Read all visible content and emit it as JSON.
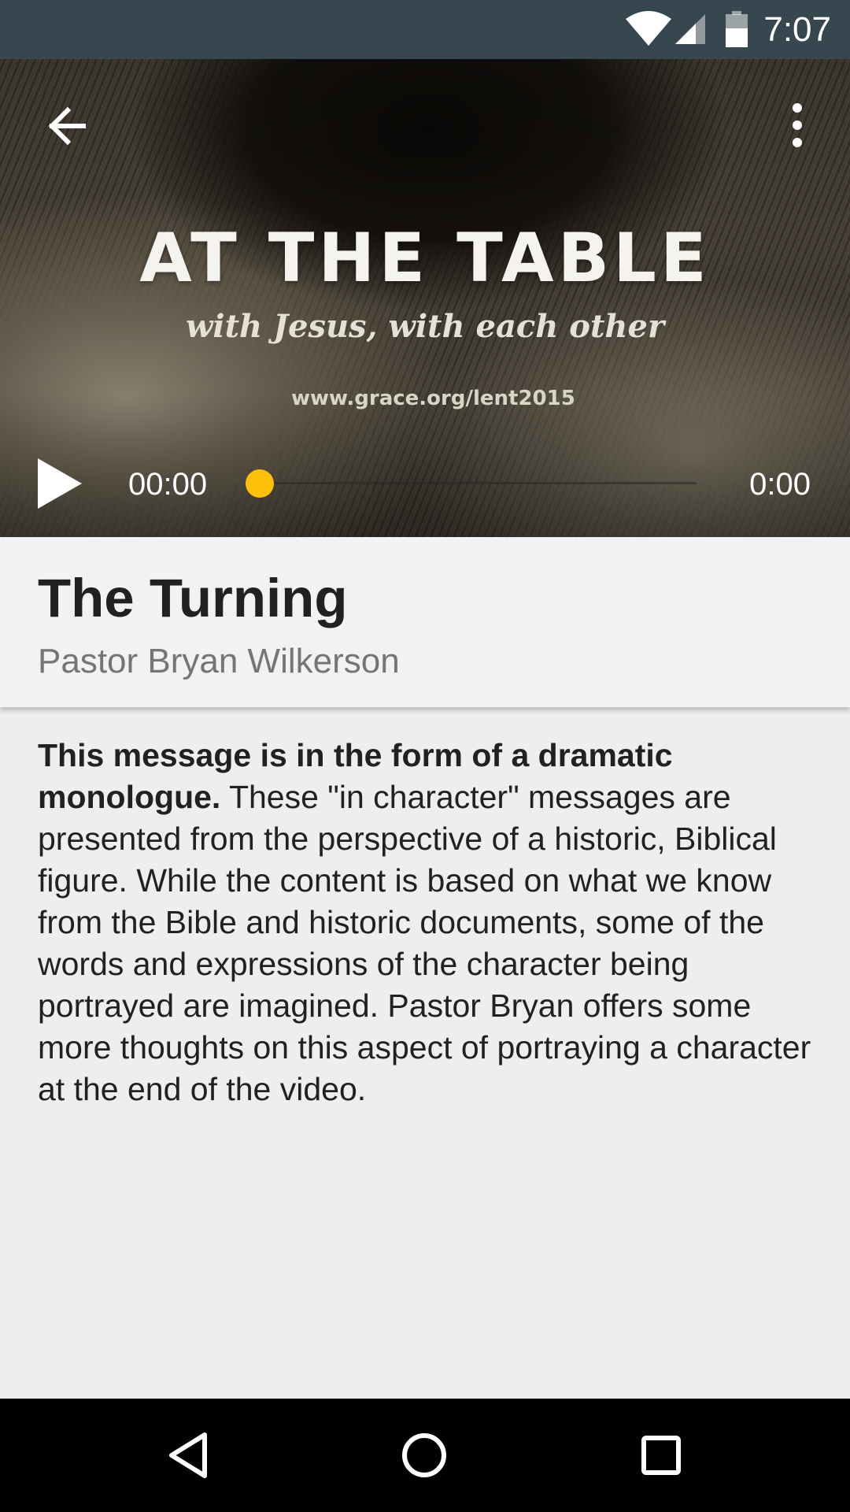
{
  "status_bar": {
    "time": "7:07",
    "icons": [
      "wifi-icon",
      "cell-signal-icon",
      "battery-icon"
    ]
  },
  "toolbar": {
    "back_icon": "arrow-back-icon",
    "menu_icon": "more-vert-icon"
  },
  "hero": {
    "title": "AT THE TABLE",
    "subtitle": "with Jesus, with each other",
    "url": "www.grace.org/lent2015"
  },
  "player": {
    "play_icon": "play-icon",
    "elapsed": "00:00",
    "duration": "0:00",
    "progress": 0,
    "accent_color": "#ffc107"
  },
  "message": {
    "title": "The Turning",
    "speaker": "Pastor Bryan Wilkerson",
    "description_bold": "This message is in the form of a dramatic monologue.",
    "description_rest": " These \"in character\" messages are presented from the perspective of a historic, Biblical figure. While the content is based on what we know from the Bible and historic documents, some of the words and expressions of the character being portrayed are imagined. Pastor Bryan offers some more thoughts on this aspect of portraying a character at the end of the video."
  },
  "nav_bar": {
    "icons": [
      "nav-back-icon",
      "nav-home-icon",
      "nav-recents-icon"
    ]
  },
  "colors": {
    "status_bar": "#37474f",
    "card": "#f2f2f2",
    "background": "#eeeeee"
  }
}
